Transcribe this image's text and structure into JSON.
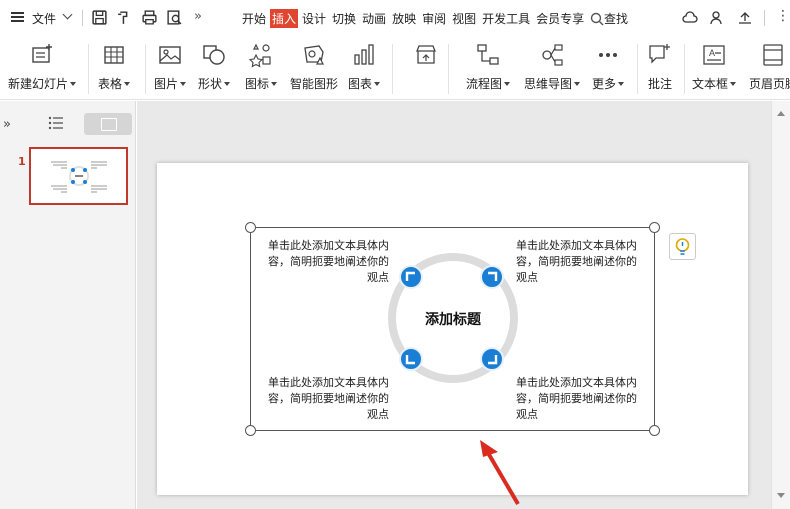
{
  "menubar": {
    "file_label": "文件",
    "tabs": [
      "开始",
      "插入",
      "设计",
      "切换",
      "动画",
      "放映",
      "审阅",
      "视图",
      "开发工具",
      "会员专享"
    ],
    "active_tab_index": 1,
    "search_label": "查找",
    "accent_color": "#e0452f"
  },
  "ribbon": {
    "new_slide": "新建幻灯片",
    "table": "表格",
    "picture": "图片",
    "shape": "形状",
    "icon": "图标",
    "smart_art": "智能图形",
    "chart": "图表",
    "flowchart": "流程图",
    "mindmap": "思维导图",
    "more": "更多",
    "comment": "批注",
    "textbox": "文本框",
    "header_footer": "页眉页脚"
  },
  "thumbnails": {
    "slide_number": "1"
  },
  "slide": {
    "title": "添加标题",
    "tl_text": "单击此处添加文本具体内容，简明扼要地阐述你的观点",
    "tr_text": "单击此处添加文本具体内容，简明扼要地阐述你的观点",
    "bl_text": "单击此处添加文本具体内容，简明扼要地阐述你的观点",
    "br_text": "单击此处添加文本具体内容，简明扼要地阐述你的观点",
    "node_color": "#1a7fd4",
    "annotation_arrow_color": "#d92b1f"
  }
}
